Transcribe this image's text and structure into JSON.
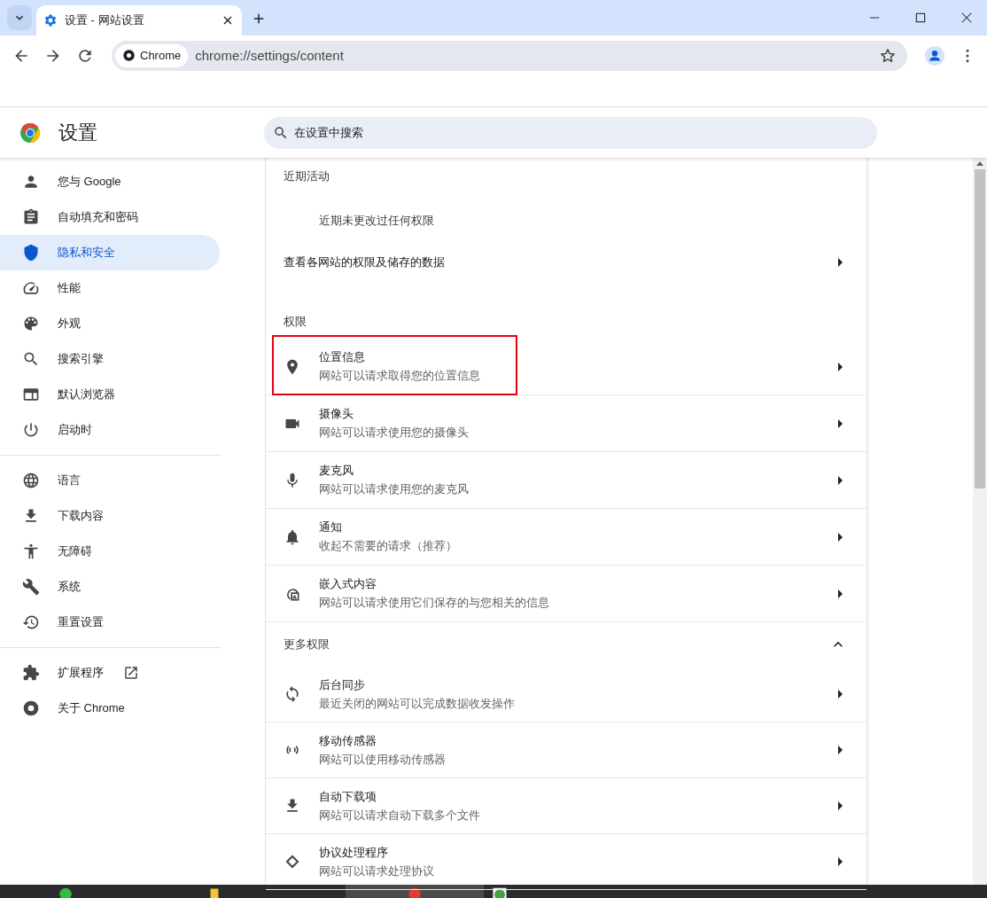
{
  "tabs": [
    {
      "title": "设置 - 网站设置",
      "selected": true
    }
  ],
  "omnibox": {
    "chip": "Chrome",
    "url": "chrome://settings/content"
  },
  "settings_header": {
    "title": "设置",
    "search": {
      "placeholder": "在设置中搜索"
    }
  },
  "sidebar": {
    "groups": [
      {
        "items": [
          {
            "kind": "person",
            "label": "您与 Google",
            "selected": false
          },
          {
            "kind": "autofill",
            "label": "自动填充和密码",
            "selected": false
          },
          {
            "kind": "shield",
            "label": "隐私和安全",
            "selected": true
          },
          {
            "kind": "gauge",
            "label": "性能",
            "selected": false
          },
          {
            "kind": "palette",
            "label": "外观",
            "selected": false
          },
          {
            "kind": "search",
            "label": "搜索引擎",
            "selected": false
          },
          {
            "kind": "browser",
            "label": "默认浏览器",
            "selected": false
          },
          {
            "kind": "power",
            "label": "启动时",
            "selected": false
          }
        ]
      },
      {
        "items": [
          {
            "kind": "globe",
            "label": "语言",
            "selected": false
          },
          {
            "kind": "download",
            "label": "下载内容",
            "selected": false
          },
          {
            "kind": "person-arms",
            "label": "无障碍",
            "selected": false
          },
          {
            "kind": "wrench",
            "label": "系统",
            "selected": false
          },
          {
            "kind": "history",
            "label": "重置设置",
            "selected": false
          }
        ]
      },
      {
        "items": [
          {
            "kind": "puzzle",
            "label": "扩展程序",
            "selected": false,
            "external": true
          },
          {
            "kind": "ring",
            "label": "关于 Chrome",
            "selected": false
          }
        ]
      }
    ]
  },
  "recent": {
    "title": "近期活动",
    "note": "近期未更改过任何权限",
    "link": "查看各网站的权限及储存的数据"
  },
  "permissions": {
    "title": "权限",
    "items": [
      {
        "kind": "location",
        "title": "位置信息",
        "description": "网站可以请求取得您的位置信息",
        "highlighted": true
      },
      {
        "kind": "camera",
        "title": "摄像头",
        "description": "网站可以请求使用您的摄像头",
        "highlighted": false
      },
      {
        "kind": "mic",
        "title": "麦克风",
        "description": "网站可以请求使用您的麦克风",
        "highlighted": false
      },
      {
        "kind": "bell",
        "title": "通知",
        "description": "收起不需要的请求（推荐）",
        "highlighted": false
      },
      {
        "kind": "embedded",
        "title": "嵌入式内容",
        "description": "网站可以请求使用它们保存的与您相关的信息",
        "highlighted": false
      }
    ]
  },
  "more_permissions": {
    "title": "更多权限",
    "expanded": true,
    "items": [
      {
        "kind": "sync",
        "title": "后台同步",
        "description": "最近关闭的网站可以完成数据收发操作"
      },
      {
        "kind": "sensor",
        "title": "移动传感器",
        "description": "网站可以使用移动传感器"
      },
      {
        "kind": "download",
        "title": "自动下载项",
        "description": "网站可以请求自动下载多个文件"
      },
      {
        "kind": "diamond",
        "title": "协议处理程序",
        "description": "网站可以请求处理协议"
      }
    ]
  }
}
